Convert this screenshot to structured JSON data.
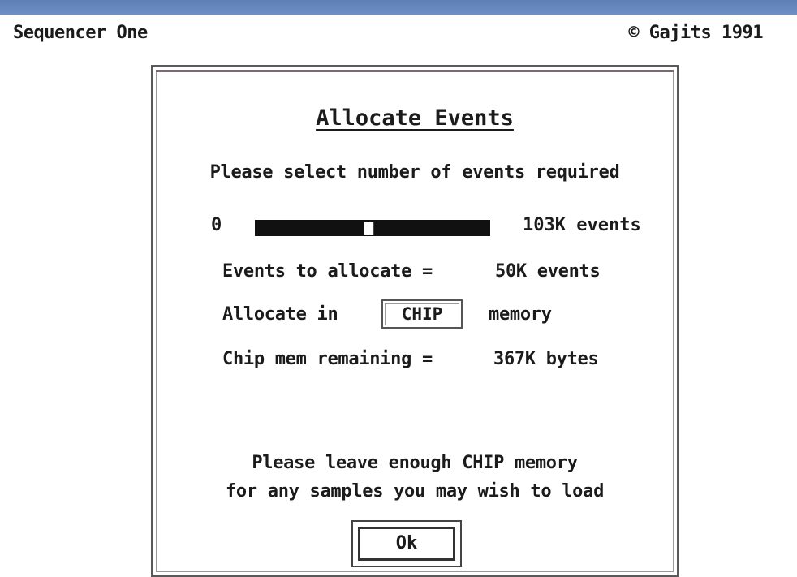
{
  "app": {
    "name": "Sequencer One",
    "copyright": "© Gajits 1991"
  },
  "dialog": {
    "title": "Allocate Events",
    "instruction": "Please select number of events required",
    "slider": {
      "min_label": "0",
      "max_label": "103K events",
      "value_fraction": 0.48
    },
    "events_to_allocate": {
      "label": "Events to allocate =",
      "value": "50K events"
    },
    "allocate_in": {
      "label": "Allocate in",
      "option": "CHIP",
      "suffix": "memory"
    },
    "chip_mem_remaining": {
      "label": "Chip mem remaining =",
      "value": "367K bytes"
    },
    "notice_line1": "Please leave enough CHIP memory",
    "notice_line2": "for any samples you may wish to load",
    "ok_label": "Ok"
  }
}
